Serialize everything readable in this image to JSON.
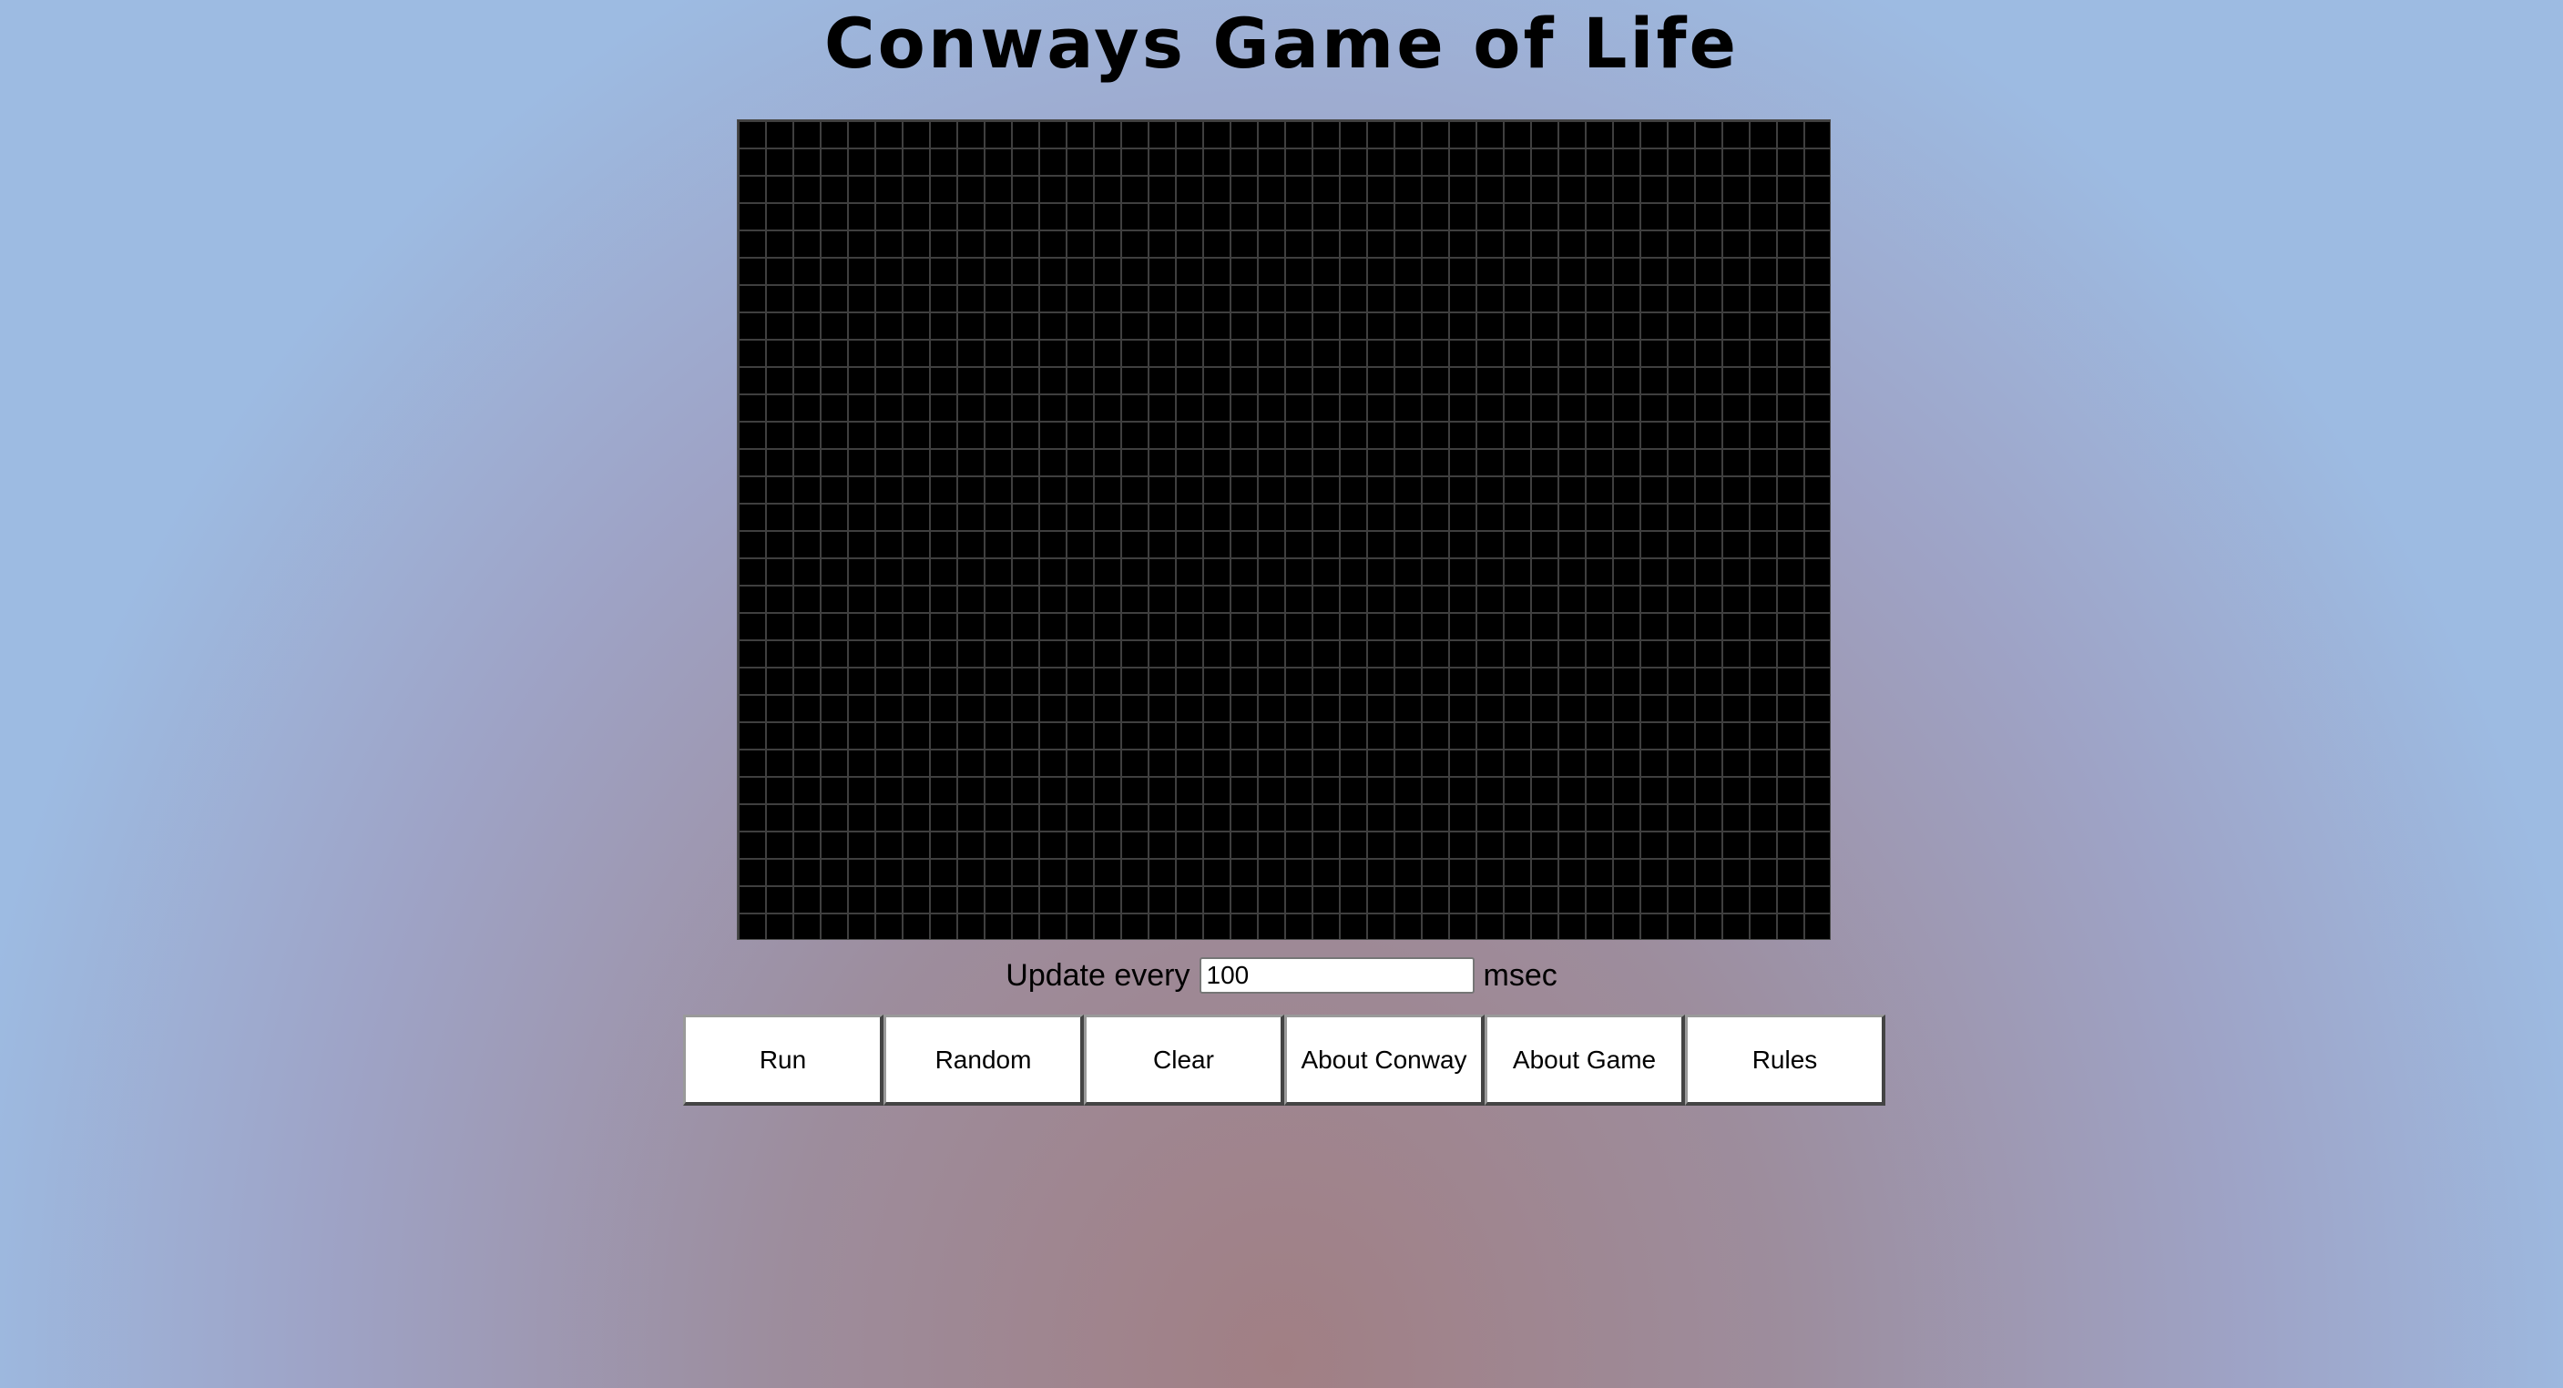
{
  "page": {
    "title": "Conways Game of Life"
  },
  "board": {
    "cell_color_dead": "#000000",
    "grid_line_color": "#3f3f3f"
  },
  "speed": {
    "label_before": "Update every",
    "value": "100",
    "label_after": "msec"
  },
  "controls": {
    "buttons": [
      {
        "label": "Run"
      },
      {
        "label": "Random"
      },
      {
        "label": "Clear"
      },
      {
        "label": "About Conway"
      },
      {
        "label": "About Game"
      },
      {
        "label": "Rules"
      }
    ]
  }
}
